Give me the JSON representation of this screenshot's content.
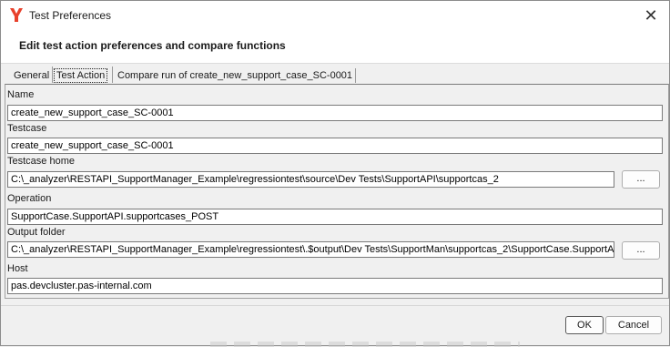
{
  "window": {
    "title": "Test Preferences",
    "header": "Edit test action preferences and compare functions"
  },
  "tabs": [
    {
      "label": "General"
    },
    {
      "label": "Test Action"
    },
    {
      "label": "Compare run of create_new_support_case_SC-0001"
    }
  ],
  "active_tab": "Test Action",
  "fields": {
    "name": {
      "label": "Name",
      "value": "create_new_support_case_SC-0001"
    },
    "testcase": {
      "label": "Testcase",
      "value": "create_new_support_case_SC-0001"
    },
    "testcase_home": {
      "label": "Testcase home",
      "value": "C:\\_analyzer\\RESTAPI_SupportManager_Example\\regressiontest\\source\\Dev Tests\\SupportAPI\\supportcas_2"
    },
    "operation": {
      "label": "Operation",
      "value": "SupportCase.SupportAPI.supportcases_POST"
    },
    "output_folder": {
      "label": "Output folder",
      "value": "C:\\_analyzer\\RESTAPI_SupportManager_Example\\regressiontest\\.$output\\Dev Tests\\SupportMan\\supportcas_2\\SupportCase.SupportAPI.supportcases_POST"
    },
    "host": {
      "label": "Host",
      "value": "pas.devcluster.pas-internal.com"
    }
  },
  "browse_label": "...",
  "buttons": {
    "ok": "OK",
    "cancel": "Cancel"
  },
  "icons": {
    "app": "app-logo-icon",
    "close": "close-icon"
  },
  "colors": {
    "app_logo": "#e8412c"
  }
}
